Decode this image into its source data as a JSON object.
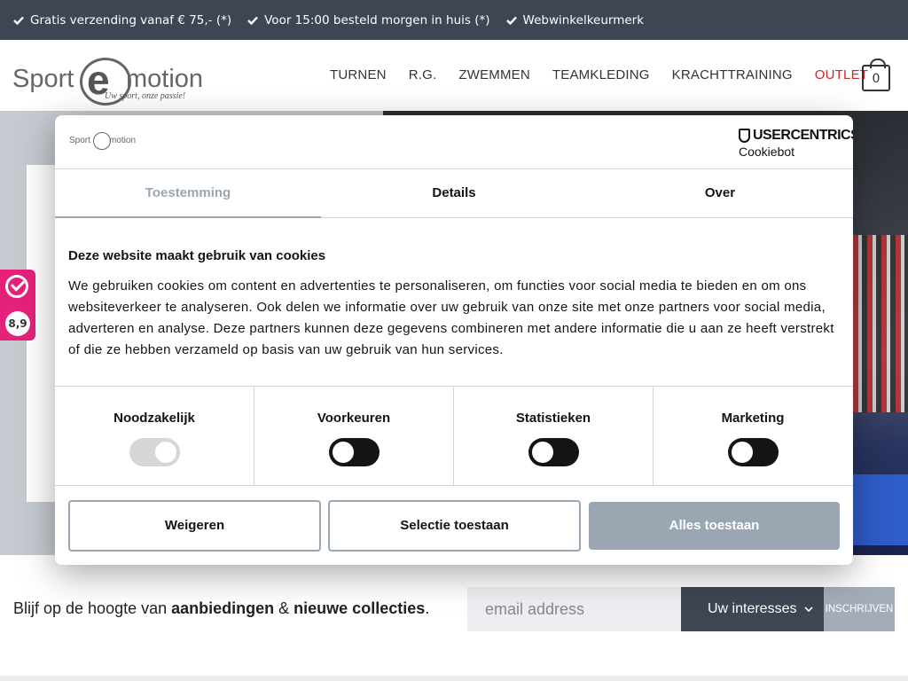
{
  "topbar": {
    "usps": [
      "Gratis verzending vanaf € 75,- (*)",
      "Voor 15:00 besteld morgen in huis (*)",
      "Webwinkelkeurmerk"
    ]
  },
  "logo": {
    "word1": "Sport",
    "letter": "e",
    "word2": "motion",
    "tagline": "Uw sport, onze passie!"
  },
  "nav": {
    "items": [
      "TURNEN",
      "R.G.",
      "ZWEMMEN",
      "TEAMKLEDING",
      "KRACHTTRAINING",
      "OUTLET"
    ],
    "outlet_color": "#d0262d"
  },
  "cart": {
    "count": "0"
  },
  "review_badge": {
    "score": "8,9",
    "color": "#e5217a"
  },
  "cookie_dialog": {
    "provider": {
      "brand": "USERCENTRICS",
      "product": "Cookiebot"
    },
    "tabs": [
      "Toestemming",
      "Details",
      "Over"
    ],
    "active_tab": "Toestemming",
    "title": "Deze website maakt gebruik van cookies",
    "text": "We gebruiken cookies om content en advertenties te personaliseren, om functies voor social media te bieden en om ons websiteverkeer te analyseren. Ook delen we informatie over uw gebruik van onze site met onze partners voor social media, adverteren en analyse. Deze partners kunnen deze gegevens combineren met andere informatie die u aan ze heeft verstrekt of die ze hebben verzameld op basis van uw gebruik van hun services.",
    "categories": [
      {
        "label": "Noodzakelijk",
        "state": "on-disabled"
      },
      {
        "label": "Voorkeuren",
        "state": "off"
      },
      {
        "label": "Statistieken",
        "state": "off"
      },
      {
        "label": "Marketing",
        "state": "off"
      }
    ],
    "buttons": {
      "deny": "Weigeren",
      "selection": "Selectie toestaan",
      "allow_all": "Alles toestaan"
    },
    "accent_color": "#9ba6b3"
  },
  "newsletter": {
    "text_prefix": "Blijf op de hoogte van ",
    "bold1": "aanbiedingen",
    "amp": " & ",
    "bold2": "nieuwe collecties",
    "suffix": ".",
    "email_placeholder": "email address",
    "interests_label": "Uw interesses",
    "subscribe_label": "INSCHRIJVEN"
  }
}
